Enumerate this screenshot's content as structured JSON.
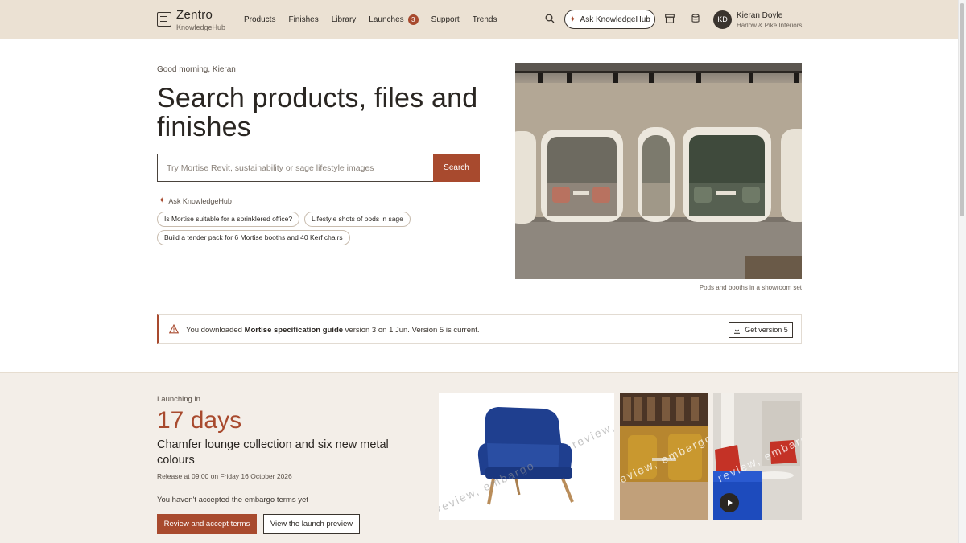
{
  "header": {
    "logo_name": "Zentro",
    "logo_sub": "KnowledgeHub",
    "nav": [
      {
        "label": "Products"
      },
      {
        "label": "Finishes"
      },
      {
        "label": "Library"
      },
      {
        "label": "Launches",
        "badge": "3"
      },
      {
        "label": "Support"
      },
      {
        "label": "Trends"
      }
    ],
    "ask_label": "Ask KnowledgeHub",
    "user": {
      "initials": "KD",
      "name": "Kieran Doyle",
      "org": "Harlow & Pike Interiors"
    }
  },
  "hero": {
    "greeting": "Good morning, Kieran",
    "title": "Search products, files and finishes",
    "search_placeholder": "Try Mortise Revit, sustainability or sage lifestyle images",
    "search_button": "Search",
    "ask_label": "Ask KnowledgeHub",
    "chips": [
      "Is Mortise suitable for a sprinklered office?",
      "Lifestyle shots of pods in sage",
      "Build a tender pack for 6 Mortise booths and 40 Kerf chairs"
    ],
    "image_caption": "Pods and booths in a showroom set"
  },
  "notice": {
    "prefix": "You downloaded",
    "doc": "Mortise specification guide",
    "suffix": "version 3 on 1 Jun. Version 5 is current.",
    "button": "Get version 5"
  },
  "launch": {
    "label": "Launching in",
    "days": "17 days",
    "title": "Chamfer lounge collection and six new metal colours",
    "release": "Release at 09:00 on Friday 16 October 2026",
    "embargo_note": "You haven't accepted the embargo terms yet",
    "accept_button": "Review and accept terms",
    "preview_button": "View the launch preview",
    "watermark_a": "review, embargo",
    "watermark_b": "review, embargo"
  },
  "colors": {
    "accent": "#a84a2e",
    "header_bg": "#ebe1d3",
    "launch_bg": "#f3eee8"
  }
}
